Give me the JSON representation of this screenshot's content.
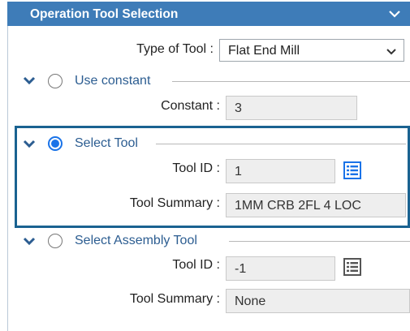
{
  "header": {
    "title": "Operation Tool Selection",
    "collapse_icon": "chevron-down-icon"
  },
  "type_of_tool": {
    "label": "Type of Tool :",
    "value": "Flat End Mill"
  },
  "use_constant": {
    "title": "Use constant",
    "selected": false,
    "constant_label": "Constant :",
    "constant_value": "3"
  },
  "select_tool": {
    "title": "Select Tool",
    "selected": true,
    "tool_id_label": "Tool ID :",
    "tool_id_value": "1",
    "summary_label": "Tool Summary :",
    "summary_value": "1MM CRB 2FL 4 LOC"
  },
  "select_assembly_tool": {
    "title": "Select Assembly Tool",
    "selected": false,
    "tool_id_label": "Tool ID :",
    "tool_id_value": "-1",
    "summary_label": "Tool Summary :",
    "summary_value": "None"
  },
  "colors": {
    "header_bg": "#3e7cb8",
    "accent": "#1a73e8",
    "highlight_border": "#1a6291",
    "section_title": "#2c5d91"
  }
}
